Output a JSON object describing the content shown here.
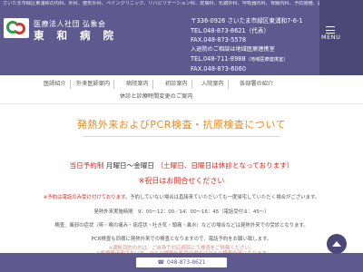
{
  "header": {
    "tagline": "さいたま市緑区東浦和の内科、外科、整形外科、ペインクリニック、リハビリテーション科、皮膚科、乳腺外科、呼吸器内科、胃腸内科、予防接種、訪問診療なら東和病院",
    "org_line1": "医療法人社団 弘象会",
    "org_line2": "東 和 病 院",
    "contact": {
      "address": "〒336-0926 さいたま市緑区東浦和7-6-1",
      "tel": "TEL.048-873-8621（代表）",
      "fax": "FAX.048-873-5578",
      "admission_note": "入退院のご相談は地域医療連携室",
      "tel2": "TEL.048-711-8988",
      "tel2_note": "（地域医療連携室）",
      "fax2": "FAX.048-873-6060"
    },
    "menu_label": "MENU"
  },
  "nav": {
    "row1": [
      "医師紹介",
      "外来医師案内",
      "病院案内",
      "初診案内",
      "入院案内",
      "各部署の紹介"
    ],
    "row2": [
      "休診と診療時間変更のご案内"
    ]
  },
  "page": {
    "title": "発熱外来およびPCR検査・抗原検査について",
    "hours_prefix": "当日予約制",
    "hours_days": "月曜日～金曜日",
    "hours_closed": "（土曜日、日曜日は休診となっております）",
    "inquiry": "※祝日はお問合せください",
    "notice_red": "※予約は電話のみ受け付けております。",
    "notice_rest": "予約していない場合は直接来ていただいても一度帰宅していただく場合がございます。",
    "line1": "発熱外来実施時間　9：00～12：00／14：00～16：45（電話受付８：45～）",
    "line2": "検査、風邪の症状（咳・喉の痛み・痰症状・吐き気・頭痛・鼻水）などの場合などは発熱外来での受診となります。",
    "line3": "PCR検査も同様に発熱外来での検査となりますので、電話予約をお願い致します。",
    "line4": "※渡航目的の方は、ご自身で対応病院にて検査をご依頼ください。",
    "line5": "※医療搬送者でない方、ＰＣＲ検査を希望の場合はＰＣＲ検査外来になります"
  },
  "footer": {
    "phone": "048-873-8621",
    "phone_icon": "phone-icon"
  },
  "colors": {
    "header_bg": "#5e5a8f",
    "accent_orange": "#e58a1f",
    "accent_red": "#d7261e"
  }
}
